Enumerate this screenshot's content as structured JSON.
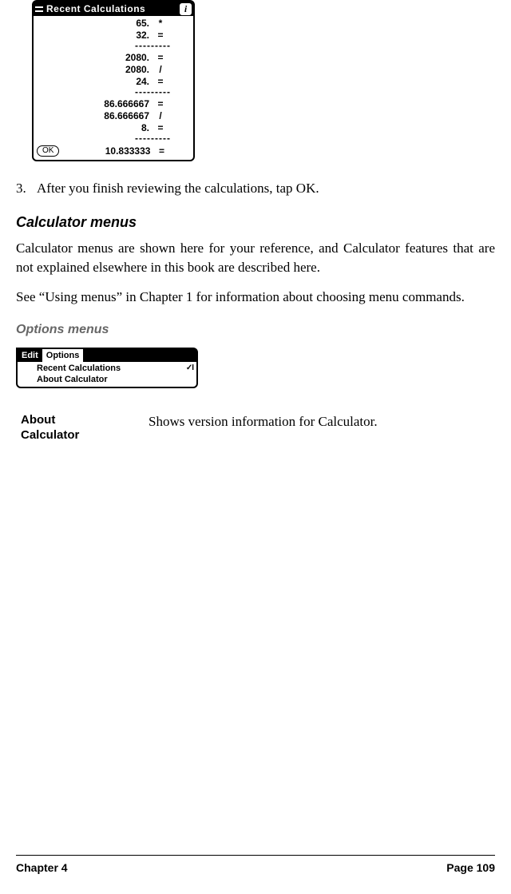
{
  "calc_window": {
    "title": "Recent Calculations",
    "info_glyph": "i",
    "ok_label": "OK",
    "rows": [
      {
        "val": "65.",
        "op": "*"
      },
      {
        "val": "32.",
        "op": "="
      },
      {
        "sep": "---------"
      },
      {
        "val": "2080.",
        "op": "="
      },
      {
        "val": "2080.",
        "op": "/"
      },
      {
        "val": "24.",
        "op": "="
      },
      {
        "sep": "---------"
      },
      {
        "val": "86.666667",
        "op": "="
      },
      {
        "val": "86.666667",
        "op": "/"
      },
      {
        "val": "8.",
        "op": "="
      },
      {
        "sep": "---------"
      },
      {
        "val": "10.833333",
        "op": "=",
        "last": true
      }
    ]
  },
  "step3": {
    "num": "3.",
    "text": "After you finish reviewing the calculations, tap OK."
  },
  "headings": {
    "calc_menus": "Calculator menus",
    "options_menus": "Options menus"
  },
  "paragraphs": {
    "p1": "Calculator menus are shown here for your reference, and Calculator features that are not explained elsewhere in this book are described here.",
    "p2": "See “Using menus” in Chapter 1 for information about choosing menu commands."
  },
  "menu": {
    "tabs": [
      "Edit",
      "Options"
    ],
    "items": [
      {
        "label": "Recent Calculations",
        "shortcut": "✓I"
      },
      {
        "label": "About Calculator",
        "shortcut": ""
      }
    ]
  },
  "definition": {
    "term1": "About",
    "term2": "Calculator",
    "desc": "Shows version information for Calculator."
  },
  "footer": {
    "left": "Chapter 4",
    "right": "Page 109"
  }
}
